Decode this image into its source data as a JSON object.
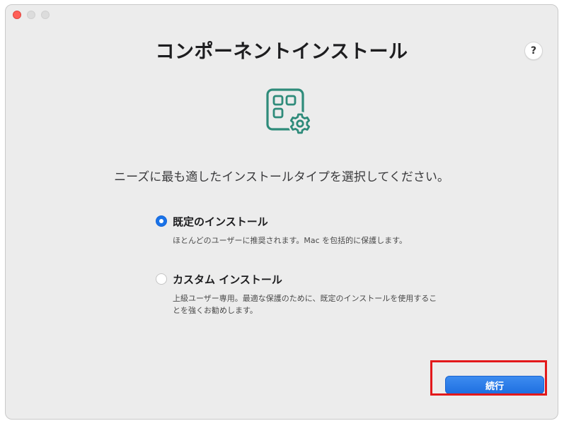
{
  "window": {
    "title": "コンポーネントインストール"
  },
  "help": {
    "label": "?"
  },
  "app_icon": {
    "name": "component-settings-icon",
    "color": "#2e8b7a"
  },
  "subtitle": "ニーズに最も適したインストールタイプを選択してください。",
  "options": [
    {
      "label": "既定のインストール",
      "description": "ほとんどのユーザーに推奨されます。Mac を包括的に保護します。",
      "selected": true
    },
    {
      "label": "カスタム インストール",
      "description": "上級ユーザー専用。最適な保護のために、既定のインストールを使用することを強くお勧めします。",
      "selected": false
    }
  ],
  "continue_button": {
    "label": "続行"
  },
  "colors": {
    "accent": "#1f6fe0",
    "highlight": "#e3191b",
    "close": "#ff5f57"
  }
}
